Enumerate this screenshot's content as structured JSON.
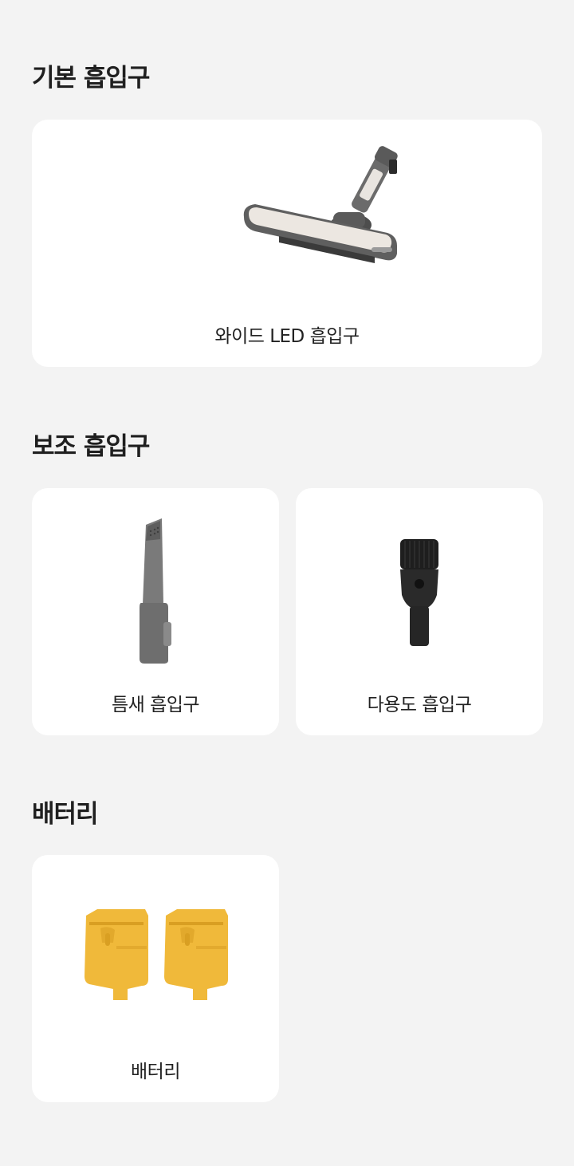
{
  "sections": [
    {
      "title": "기본 흡입구",
      "items": [
        {
          "label": "와이드 LED 흡입구",
          "icon": "floor-nozzle-icon"
        }
      ]
    },
    {
      "title": "보조 흡입구",
      "items": [
        {
          "label": "틈새 흡입구",
          "icon": "crevice-tool-icon"
        },
        {
          "label": "다용도 흡입구",
          "icon": "multi-brush-icon"
        }
      ]
    },
    {
      "title": "배터리",
      "items": [
        {
          "label": "배터리",
          "icon": "battery-pack-icon"
        }
      ]
    }
  ],
  "colors": {
    "background": "#f3f3f3",
    "card": "#ffffff",
    "battery": "#f0b93a",
    "tool_gray": "#6a6a6a"
  }
}
